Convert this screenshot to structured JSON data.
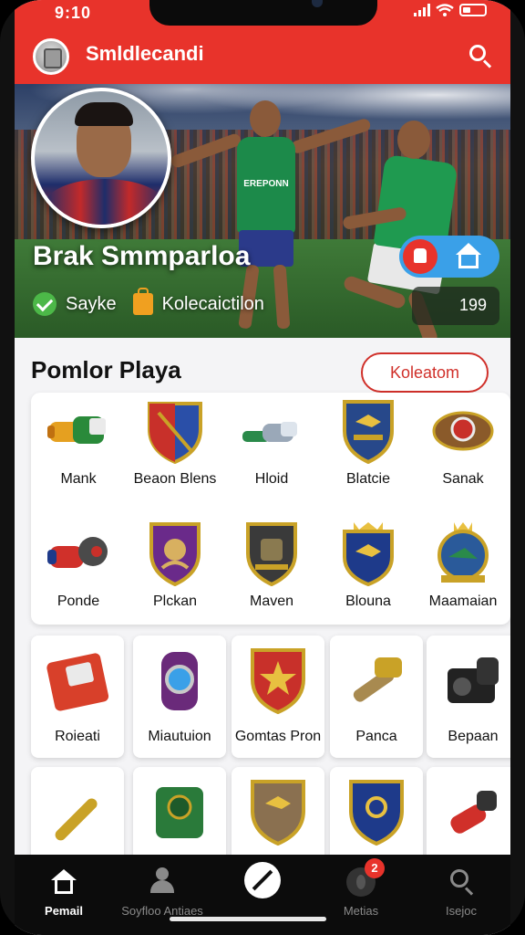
{
  "status_bar": {
    "time": "9:10"
  },
  "header": {
    "title": "Smldlecandi"
  },
  "hero": {
    "player_name": "Brak Smmparloa",
    "badge_1": "Sayke",
    "badge_2": "Kolecaictilon",
    "count": "199",
    "jersey_text": "EREPONN"
  },
  "section": {
    "title": "Pomlor Playa",
    "button_label": "Koleatom"
  },
  "featured_items": [
    {
      "label": "Mank",
      "icon": "cannon-icon"
    },
    {
      "label": "Beaon Blens",
      "icon": "shield-icon"
    },
    {
      "label": "Hloid",
      "icon": "cannon-icon"
    },
    {
      "label": "Blatcie",
      "icon": "shield-icon"
    },
    {
      "label": "Sanak",
      "icon": "emblem-icon"
    },
    {
      "label": "Ponde",
      "icon": "cannon-icon"
    },
    {
      "label": "Plckan",
      "icon": "shield-icon"
    },
    {
      "label": "Maven",
      "icon": "shield-icon"
    },
    {
      "label": "Blouna",
      "icon": "shield-icon"
    },
    {
      "label": "Maamaian",
      "icon": "emblem-icon"
    }
  ],
  "tiles": [
    {
      "label": "Roieati",
      "icon": "box-icon"
    },
    {
      "label": "Miautuion",
      "icon": "gem-icon"
    },
    {
      "label": "Gomtas Pron",
      "icon": "shield-icon"
    },
    {
      "label": "Panca",
      "icon": "cannon-icon"
    },
    {
      "label": "Bepaan",
      "icon": "camera-icon"
    },
    {
      "label": "",
      "icon": "cannon-icon"
    },
    {
      "label": "",
      "icon": "box-icon"
    },
    {
      "label": "",
      "icon": "shield-icon"
    },
    {
      "label": "",
      "icon": "shield-icon"
    },
    {
      "label": "",
      "icon": "cannon-icon"
    }
  ],
  "nav": {
    "items": [
      {
        "label": "Pemail"
      },
      {
        "label": "Soyfloo Antiaes"
      },
      {
        "label": ""
      },
      {
        "label": "Metias",
        "badge": "2"
      },
      {
        "label": "Isejoc"
      }
    ]
  },
  "colors": {
    "accent": "#e8332b",
    "hero_button": "#3aa0e8",
    "nav_bg": "#0c0c0c"
  }
}
